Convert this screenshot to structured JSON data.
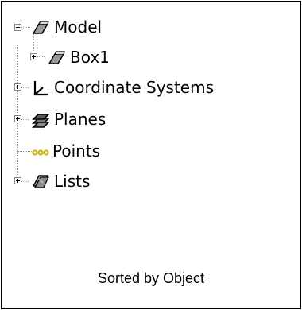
{
  "tree": {
    "model": {
      "label": "Model",
      "icon": "part-icon",
      "expanded": true
    },
    "box1": {
      "label": "Box1",
      "icon": "part-icon",
      "expanded": false
    },
    "coord": {
      "label": "Coordinate Systems",
      "icon": "axis-icon",
      "expanded": false
    },
    "planes": {
      "label": "Planes",
      "icon": "planes-icon",
      "expanded": false
    },
    "points": {
      "label": "Points",
      "icon": "points-icon"
    },
    "lists": {
      "label": "Lists",
      "icon": "lists-icon",
      "expanded": false
    }
  },
  "caption": "Sorted by Object",
  "colors": {
    "part_fill": "#9a9a9a",
    "point_color": "#c8b400",
    "line": "#9a9a9a"
  }
}
